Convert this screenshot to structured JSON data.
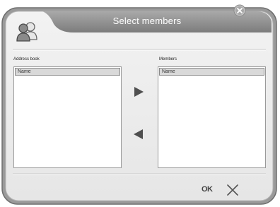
{
  "window": {
    "title": "Select members"
  },
  "left_panel": {
    "label": "Address book",
    "column_header": "Name",
    "rows": []
  },
  "right_panel": {
    "label": "Members",
    "column_header": "Name",
    "rows": []
  },
  "buttons": {
    "ok_label": "OK"
  },
  "icons": {
    "avatar": "contacts-icon",
    "close_top": "close-icon",
    "add": "arrow-right-icon",
    "remove": "arrow-left-icon",
    "cancel": "cancel-x-icon"
  },
  "colors": {
    "title_bar": "#8c8c8c",
    "window_body": "#ececec",
    "frame_border": "#6f6f6f",
    "arrow": "#555555"
  }
}
